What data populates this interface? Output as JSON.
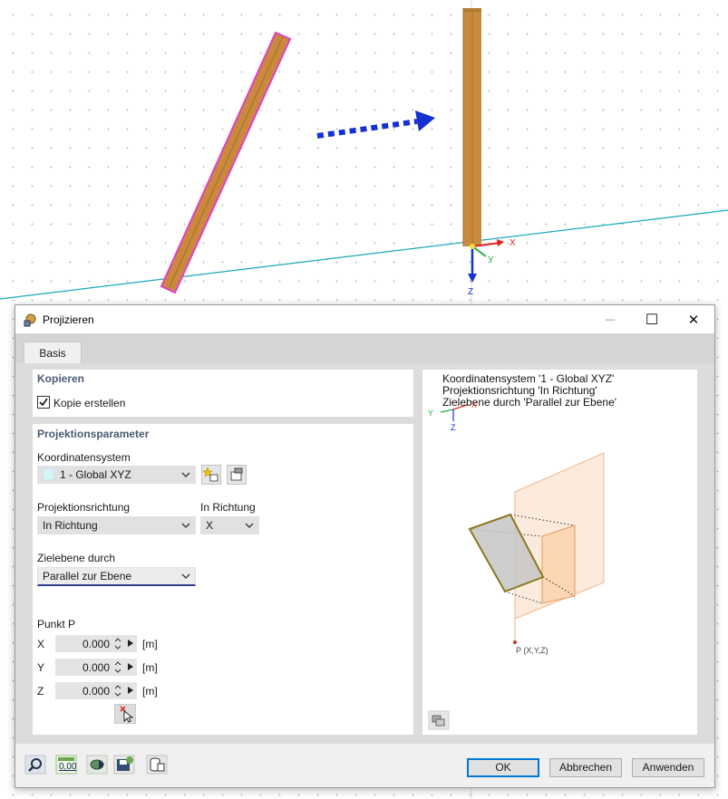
{
  "viewport": {
    "axes": {
      "x": "X",
      "y": "Y",
      "z": "Z"
    }
  },
  "dialog": {
    "title": "Projizieren",
    "window_controls": {
      "minimize": "—",
      "maximize": "☐",
      "close": "✕"
    },
    "tabs": [
      {
        "label": "Basis"
      }
    ],
    "kopieren": {
      "title": "Kopieren",
      "checkbox_label": "Kopie erstellen",
      "checked": true
    },
    "projektionsparameter": {
      "title": "Projektionsparameter",
      "koordinatensystem_label": "Koordinatensystem",
      "koordinatensystem_value": "1 - Global XYZ",
      "projektionsrichtung_label": "Projektionsrichtung",
      "projektionsrichtung_value": "In Richtung",
      "in_richtung_label": "In Richtung",
      "in_richtung_value": "X",
      "zielebene_label": "Zielebene durch",
      "zielebene_value": "Parallel zur Ebene",
      "punkt_label": "Punkt P",
      "punkt": [
        {
          "axis": "X",
          "value": "0.000",
          "unit": "[m]"
        },
        {
          "axis": "Y",
          "value": "0.000",
          "unit": "[m]"
        },
        {
          "axis": "Z",
          "value": "0.000",
          "unit": "[m]"
        }
      ]
    },
    "preview": {
      "line1": "Koordinatensystem '1 - Global XYZ'",
      "line2": "Projektionsrichtung 'In Richtung'",
      "line3": "Zielebene durch 'Parallel zur Ebene'",
      "mini_axes": {
        "y": "Y",
        "x": "X",
        "z": "Z"
      },
      "point_label": "P (X,Y,Z)"
    },
    "footer": {
      "ok": "OK",
      "cancel": "Abbrechen",
      "apply": "Anwenden",
      "units_icon_text": "0,00"
    }
  },
  "colors": {
    "member": "#c98a3d",
    "selection": "#e040c8",
    "arrow": "#1530d0",
    "axis_line": "#1aa8b8",
    "section_title": "#4c5b73"
  }
}
